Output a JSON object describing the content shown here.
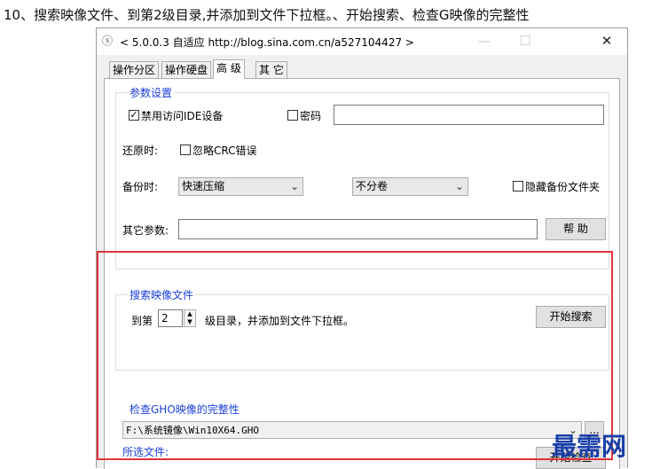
{
  "heading": "10、搜索映像文件、到第2级目录,并添加到文件下拉框。、开始搜索、检查G映像的完整性",
  "window": {
    "title": "< 5.0.0.3 自适应 http://blog.sina.com.cn/a527104427 >",
    "icon": "app-icon",
    "minimize": "—",
    "maximize": "☐",
    "close": "✕"
  },
  "tabs": [
    {
      "label": "操作分区",
      "active": false
    },
    {
      "label": "操作硬盘",
      "active": false
    },
    {
      "label": "高 级",
      "active": true
    },
    {
      "label": "其 它",
      "active": false
    }
  ],
  "params": {
    "legend": "参数设置",
    "disable_ide_label": "禁用访问IDE设备",
    "disable_ide_checked": true,
    "password_label": "密码",
    "password_checked": false,
    "password_value": "",
    "restore_label": "还原时:",
    "ignore_crc_label": "忽略CRC错误",
    "ignore_crc_checked": false,
    "backup_label": "备份时:",
    "compression_value": "快速压缩",
    "split_value": "不分卷",
    "hide_backup_label": "隐藏备份文件夹",
    "hide_backup_checked": false,
    "other_params_label": "其它参数:",
    "other_params_value": "",
    "help_button": "帮 助"
  },
  "search": {
    "legend": "搜索映像文件",
    "prefix": "到第",
    "depth_value": "2",
    "suffix": "级目录，并添加到文件下拉框。",
    "start_button": "开始搜索"
  },
  "check": {
    "legend": "检查GHO映像的完整性",
    "file_value": "F:\\系统镜像\\Win10X64.GHO",
    "browse_button": "...",
    "selected_label": "所选文件:",
    "start_button": "开始检查"
  },
  "highlight_color": "#e0343c",
  "accent_color": "#1a3fd6",
  "watermark": "最需网"
}
